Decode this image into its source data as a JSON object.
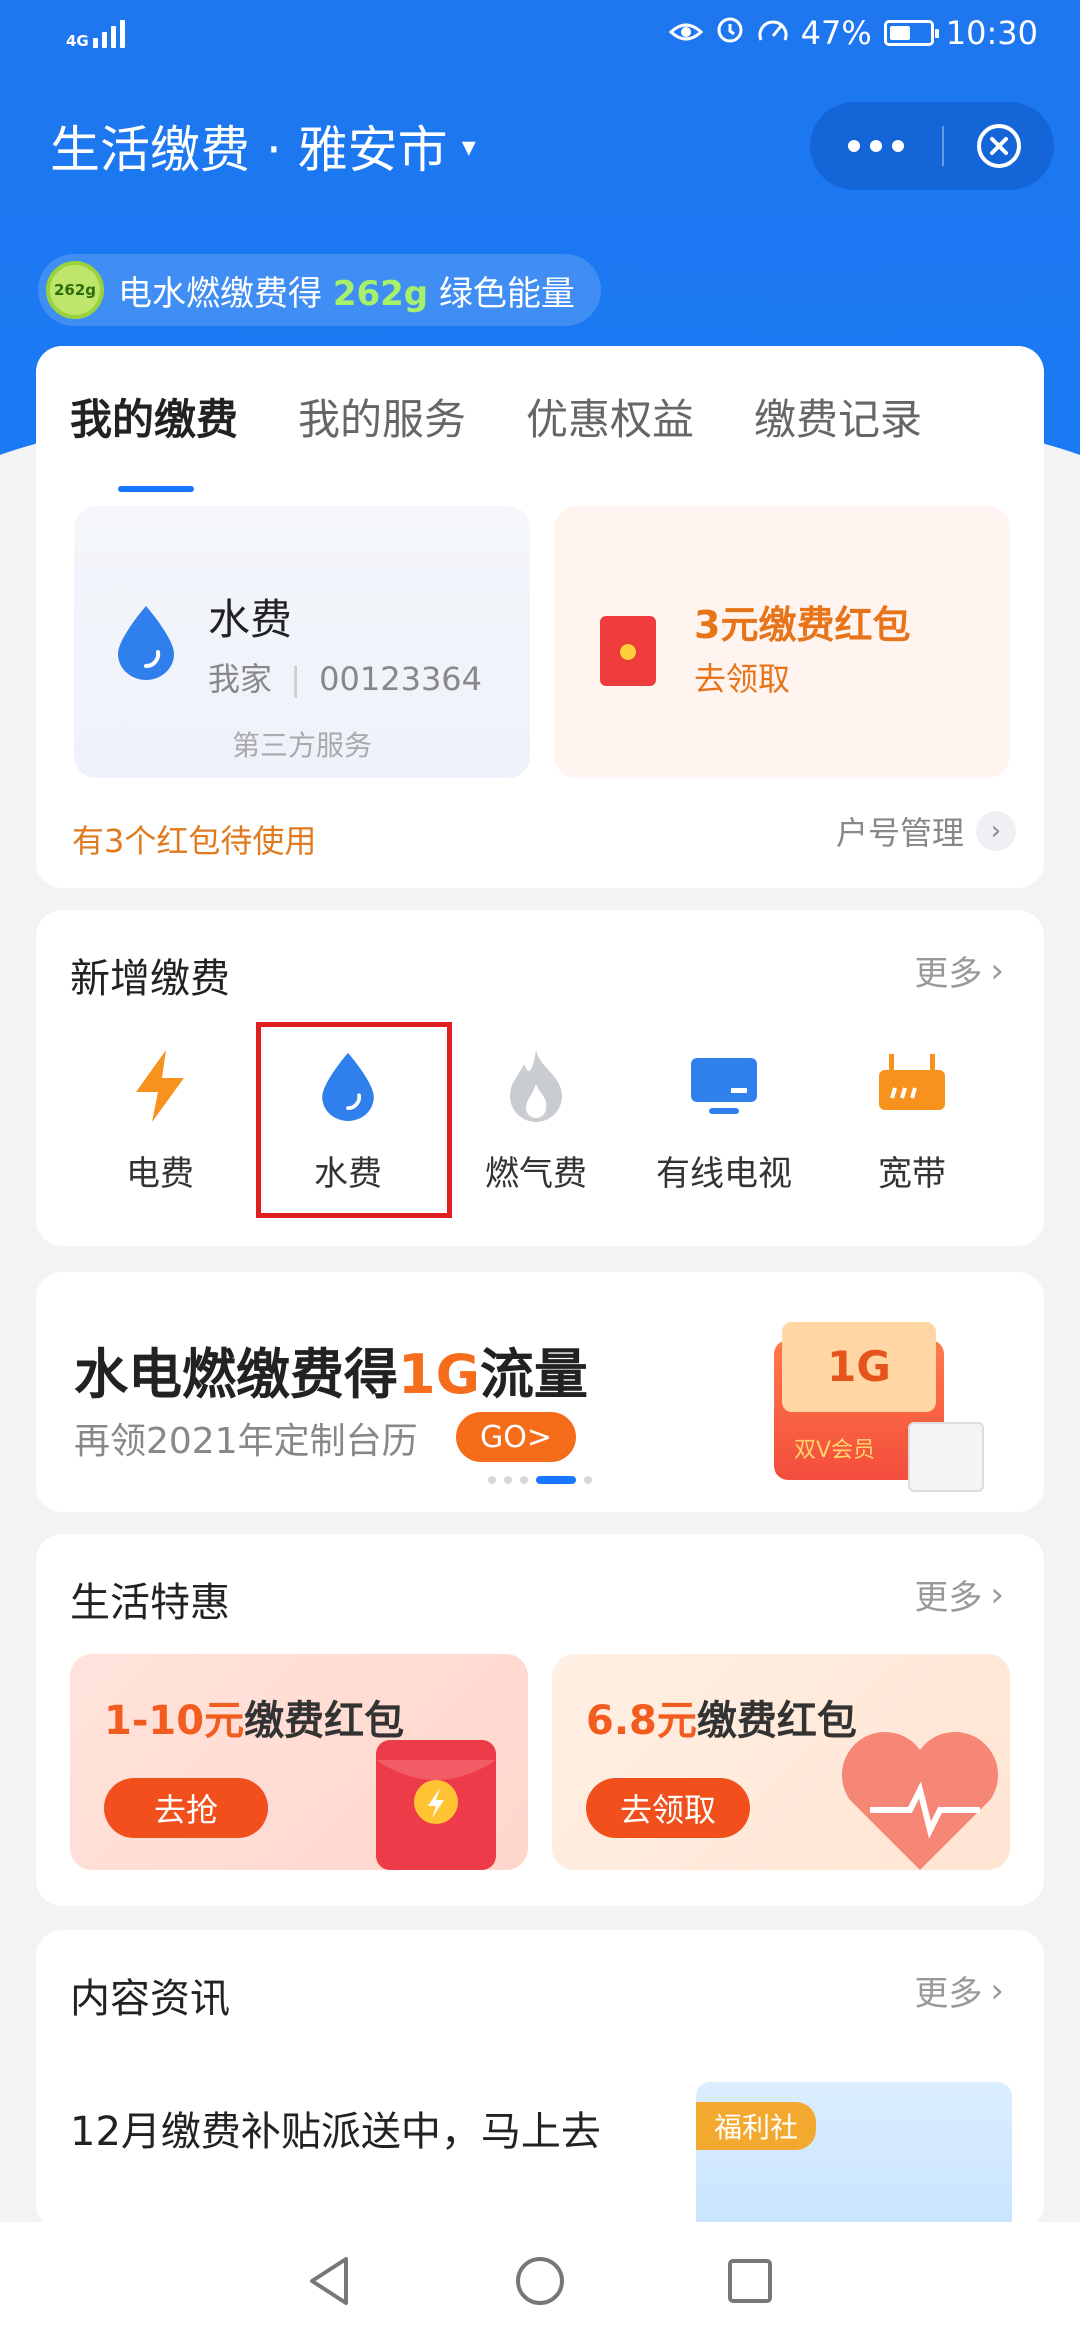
{
  "status_bar": {
    "network": "4G",
    "battery": "47%",
    "time": "10:30"
  },
  "title_bar": {
    "title": "生活缴费 · 雅安市",
    "caret": "▾"
  },
  "energy_banner": {
    "badge": "262g",
    "text_before": "电水燃缴费得",
    "amount": "262g",
    "text_after": "绿色能量"
  },
  "tabs": [
    "我的缴费",
    "我的服务",
    "优惠权益",
    "缴费记录"
  ],
  "my_bill": {
    "water": {
      "name": "水费",
      "household": "我家",
      "account": "00123364",
      "footer": "第三方服务"
    },
    "redpack": {
      "title": "3元缴费红包",
      "action": "去领取"
    },
    "pending": "有3个红包待使用",
    "manage": "户号管理"
  },
  "new_payment": {
    "title": "新增缴费",
    "more": "更多",
    "items": [
      {
        "label": "电费",
        "icon": "lightning-icon"
      },
      {
        "label": "水费",
        "icon": "water-drop-icon"
      },
      {
        "label": "燃气费",
        "icon": "flame-icon"
      },
      {
        "label": "有线电视",
        "icon": "tv-icon"
      },
      {
        "label": "宽带",
        "icon": "router-icon"
      }
    ]
  },
  "banner": {
    "headline_prefix": "水电燃缴费得",
    "headline_highlight": "1G",
    "headline_suffix": "流量",
    "sub": "再领2021年定制台历",
    "go": "GO>",
    "gift_amount": "1G",
    "gift_label": "双V会员"
  },
  "life_deals": {
    "title": "生活特惠",
    "more": "更多",
    "cards": [
      {
        "amount": "1-10元",
        "text": "缴费红包",
        "button": "去抢"
      },
      {
        "amount": "6.8元",
        "text": "缴费红包",
        "button": "去领取"
      }
    ]
  },
  "news": {
    "title": "内容资讯",
    "more": "更多",
    "headline": "12月缴费补贴派送中，马上去",
    "tag": "福利社"
  },
  "colors": {
    "brand_blue": "#1a7af4",
    "accent_orange": "#f56c1b",
    "highlight_red": "#e02020"
  }
}
